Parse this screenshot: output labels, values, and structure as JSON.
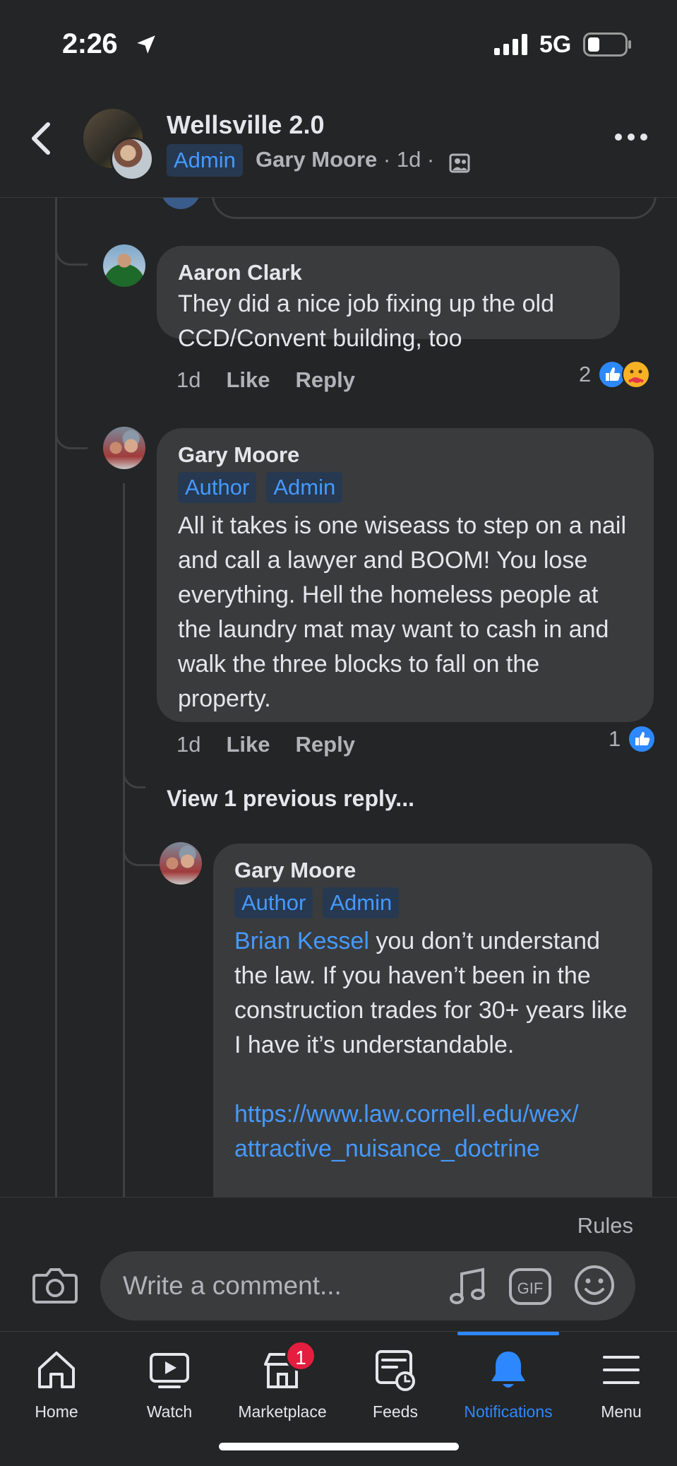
{
  "status_bar": {
    "time": "2:26",
    "network": "5G"
  },
  "header": {
    "group_name": "Wellsville 2.0",
    "admin_badge": "Admin",
    "author": "Gary Moore",
    "meta": " · 1d · "
  },
  "comments": [
    {
      "name": "Aaron Clark",
      "text": "They did a nice job fixing up the old CCD/Convent building, too",
      "time": "1d",
      "like": "Like",
      "reply": "Reply",
      "reaction_count": "2"
    },
    {
      "name": "Gary Moore",
      "badges": [
        "Author",
        "Admin"
      ],
      "text": "All it takes is one wiseass to step on a nail and call a lawyer and BOOM! You lose everything. Hell the homeless people at the laundry mat may want to cash in and walk the three blocks to fall on the property.",
      "time": "1d",
      "like": "Like",
      "reply": "Reply",
      "reaction_count": "1"
    }
  ],
  "view_previous": "View 1 previous reply...",
  "reply": {
    "name": "Gary Moore",
    "badges": [
      "Author",
      "Admin"
    ],
    "mention": "Brian Kessel",
    "text": " you don’t understand the law. If you haven’t been in the construction trades for 30+ years like I have it’s understandable.",
    "link_line1": "https://www.law.cornell.edu/wex/",
    "link_line2": "attractive_nuisance_doctrine"
  },
  "composer": {
    "rules": "Rules",
    "placeholder": "Write a comment...",
    "gif_label": "GIF"
  },
  "tabs": [
    {
      "label": "Home",
      "icon": "home-icon"
    },
    {
      "label": "Watch",
      "icon": "watch-icon"
    },
    {
      "label": "Marketplace",
      "icon": "marketplace-icon",
      "badge": "1"
    },
    {
      "label": "Feeds",
      "icon": "feeds-icon"
    },
    {
      "label": "Notifications",
      "icon": "bell-icon",
      "active": true
    },
    {
      "label": "Menu",
      "icon": "menu-icon"
    }
  ],
  "colors": {
    "accent": "#2d88ff",
    "badge_bg": "#263951",
    "badge_text": "#4599ff",
    "bubble": "#3a3b3c",
    "background": "#242526",
    "notification": "#e41e3f"
  }
}
